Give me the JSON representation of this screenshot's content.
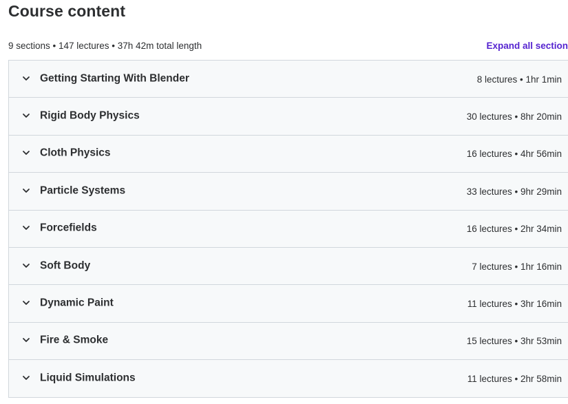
{
  "header": {
    "title": "Course content",
    "summary": "9 sections • 147 lectures • 37h 42m total length",
    "expand_all": "Expand all section"
  },
  "icons": {
    "section_toggle": "chevron-down-icon"
  },
  "colors": {
    "accent": "#5624d0",
    "section_bg": "#f7f9fa",
    "border": "#d1d7dc",
    "text": "#2d2f31"
  },
  "sections": [
    {
      "title": "Getting Starting With Blender",
      "meta": "8 lectures • 1hr 1min"
    },
    {
      "title": "Rigid Body Physics",
      "meta": "30 lectures • 8hr 20min"
    },
    {
      "title": "Cloth Physics",
      "meta": "16 lectures • 4hr 56min"
    },
    {
      "title": "Particle Systems",
      "meta": "33 lectures • 9hr 29min"
    },
    {
      "title": "Forcefields",
      "meta": "16 lectures • 2hr 34min"
    },
    {
      "title": "Soft Body",
      "meta": "7 lectures • 1hr 16min"
    },
    {
      "title": "Dynamic Paint",
      "meta": "11 lectures • 3hr 16min"
    },
    {
      "title": "Fire & Smoke",
      "meta": "15 lectures • 3hr 53min"
    },
    {
      "title": "Liquid Simulations",
      "meta": "11 lectures • 2hr 58min"
    }
  ]
}
